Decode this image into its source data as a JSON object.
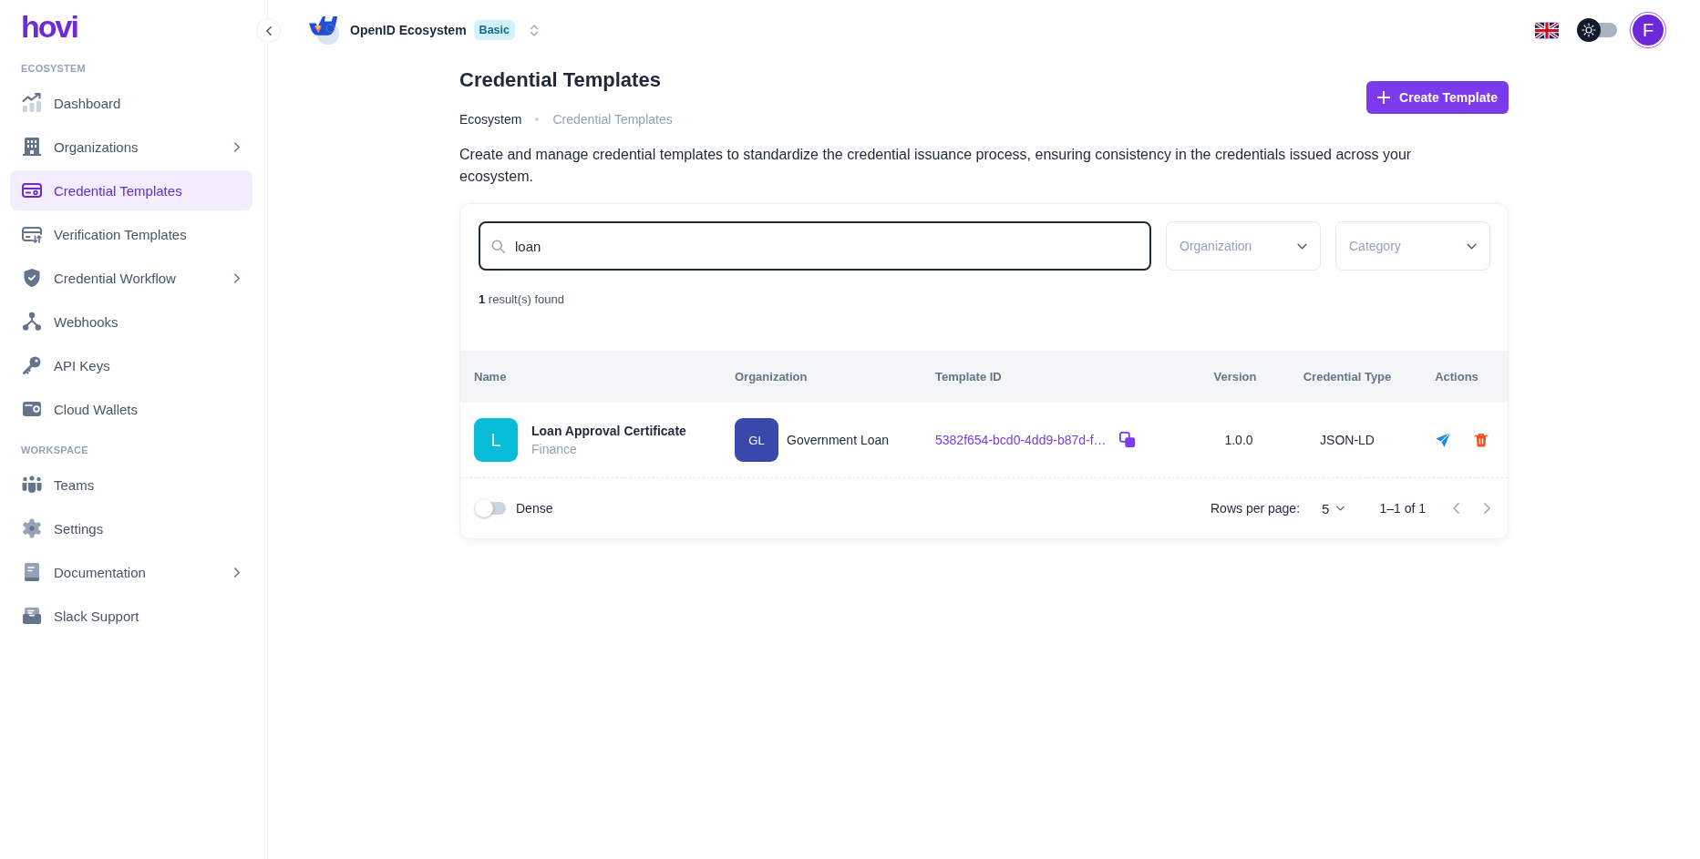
{
  "sidebar": {
    "logo": "hovi",
    "sections": [
      {
        "heading": "ECOSYSTEM",
        "items": [
          {
            "label": "Dashboard",
            "selected": false,
            "expandable": false
          },
          {
            "label": "Organizations",
            "selected": false,
            "expandable": true
          },
          {
            "label": "Credential Templates",
            "selected": true,
            "expandable": false
          },
          {
            "label": "Verification Templates",
            "selected": false,
            "expandable": false
          },
          {
            "label": "Credential Workflow",
            "selected": false,
            "expandable": true
          },
          {
            "label": "Webhooks",
            "selected": false,
            "expandable": false
          },
          {
            "label": "API Keys",
            "selected": false,
            "expandable": false
          },
          {
            "label": "Cloud Wallets",
            "selected": false,
            "expandable": false
          }
        ]
      },
      {
        "heading": "WORKSPACE",
        "items": [
          {
            "label": "Teams",
            "selected": false,
            "expandable": false
          },
          {
            "label": "Settings",
            "selected": false,
            "expandable": false
          },
          {
            "label": "Documentation",
            "selected": false,
            "expandable": true
          },
          {
            "label": "Slack Support",
            "selected": false,
            "expandable": false
          }
        ]
      }
    ]
  },
  "topbar": {
    "ecosystem": "OpenID Ecosystem",
    "plan": "Basic",
    "theme_toggle": {
      "on": false
    },
    "avatar": "F"
  },
  "page": {
    "title": "Credential Templates",
    "create_button": "Create Template",
    "breadcrumb": [
      {
        "label": "Ecosystem",
        "current": false
      },
      {
        "label": "Credential Templates",
        "current": true
      }
    ],
    "description": "Create and manage credential templates to standardize the credential issuance process, ensuring consistency in the credentials issued across your ecosystem."
  },
  "filters": {
    "search": {
      "value": "loan"
    },
    "selects": [
      {
        "placeholder": "Organization"
      },
      {
        "placeholder": "Category"
      }
    ],
    "result_summary": "**1** result(s) found"
  },
  "table": {
    "columns": [
      "Name",
      "Organization",
      "Template ID",
      "Version",
      "Credential Type",
      "Actions"
    ],
    "rows": [
      {
        "avatar": "L",
        "name": "Loan Approval Certificate",
        "category": "Finance",
        "organization_avatar": "GL",
        "organization": "Government Loan",
        "template_id": "5382f654-bcd0-4dd9-b87d-f…",
        "version": "1.0.0",
        "credential_type": "JSON-LD"
      }
    ]
  },
  "pagination": {
    "dense": {
      "label": "Dense",
      "on": false
    },
    "rows_per_page_label": "Rows per page:",
    "rows_per_page": "5",
    "range": "1–1 of 1",
    "previous": {
      "disabled": true
    },
    "next": {
      "disabled": true
    }
  }
}
